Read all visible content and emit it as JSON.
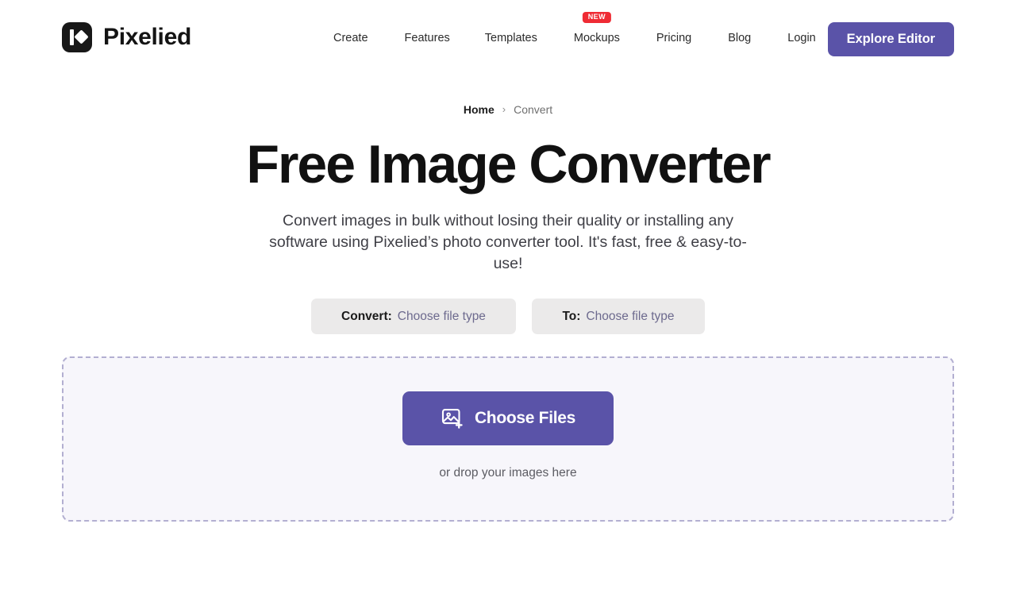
{
  "brand": {
    "name": "Pixelied",
    "logo_icon": "pixelied-logo-icon"
  },
  "nav": {
    "items": [
      {
        "label": "Create",
        "badge": null
      },
      {
        "label": "Features",
        "badge": null
      },
      {
        "label": "Templates",
        "badge": null
      },
      {
        "label": "Mockups",
        "badge": "NEW"
      },
      {
        "label": "Pricing",
        "badge": null
      },
      {
        "label": "Blog",
        "badge": null
      },
      {
        "label": "Login",
        "badge": null
      }
    ],
    "cta_label": "Explore Editor"
  },
  "breadcrumb": {
    "home": "Home",
    "separator": "›",
    "current": "Convert"
  },
  "hero": {
    "title": "Free Image Converter",
    "subtitle": "Convert images in bulk without losing their quality or installing any software using Pixelied’s photo converter tool. It's fast, free & easy-to-use!"
  },
  "converter": {
    "from": {
      "label": "Convert:",
      "value": "Choose file type"
    },
    "to": {
      "label": "To:",
      "value": "Choose file type"
    }
  },
  "dropzone": {
    "button_label": "Choose Files",
    "button_icon": "add-image-icon",
    "hint": "or drop your images here"
  },
  "colors": {
    "accent": "#5a53a8",
    "badge_red": "#ef2b34",
    "pill_bg": "#ebeaea",
    "dropzone_bg": "#f7f6fb",
    "dropzone_border": "#b3afd1",
    "text_dark": "#111111",
    "text_muted": "#6f6f6f"
  }
}
